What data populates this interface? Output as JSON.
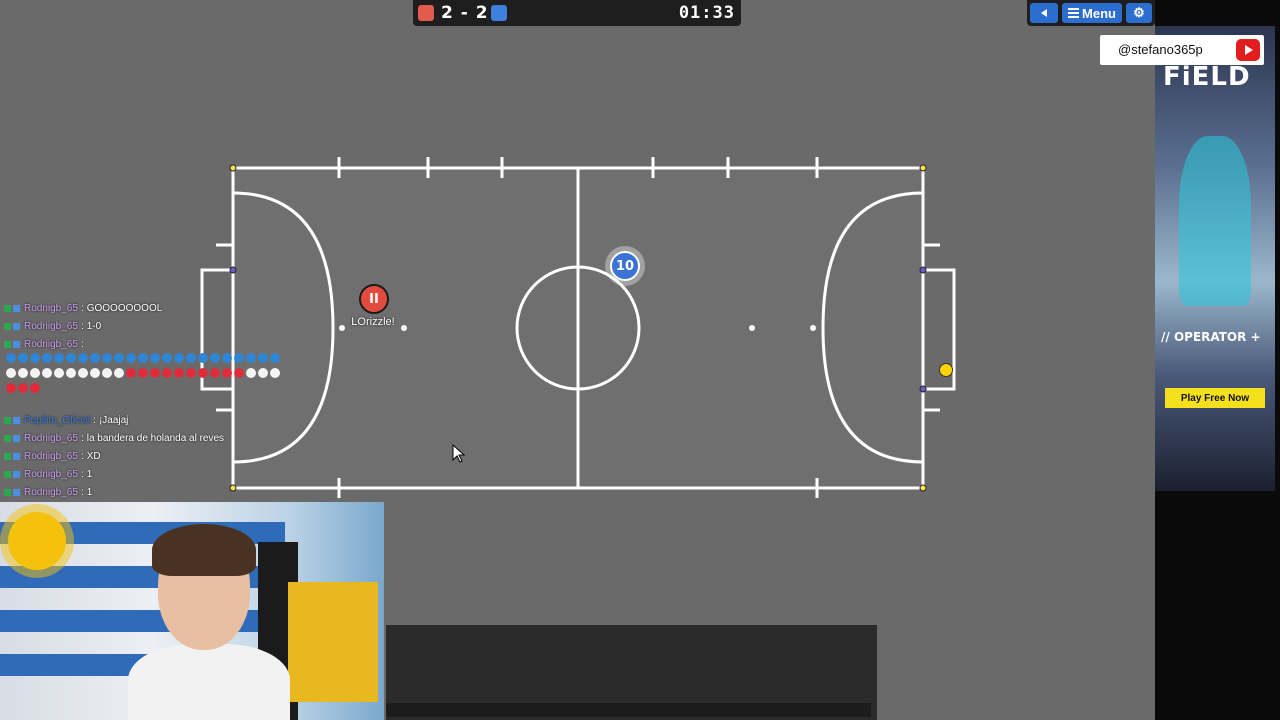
{
  "scoreboard": {
    "red_score": "2",
    "separator": "-",
    "blue_score": "2",
    "score_display": "2 - 2",
    "time": "01:33",
    "red_color": "#e35b4c",
    "blue_color": "#3f7fe0"
  },
  "menu": {
    "back_icon": "triangle-left-icon",
    "menu_label": "Menu",
    "menu_icon": "hamburger-icon",
    "settings_icon": "gear-icon"
  },
  "ad": {
    "title": "FiELD",
    "operator_label": "// OPERATOR +",
    "play_label": "Play Free Now"
  },
  "stream": {
    "handle": "@stefano365p",
    "platform_icon": "youtube-icon"
  },
  "players": {
    "red": {
      "number": "II",
      "name": "LOrizzle!"
    },
    "blue": {
      "number": "10"
    }
  },
  "chat": {
    "lines": [
      {
        "user": "Rodriigb_65",
        "sep": ":",
        "msg": "GOOOOOOOOL"
      },
      {
        "user": "Rodriigb_65",
        "sep": ":",
        "msg": "1-0"
      },
      {
        "user": "Rodriigb_65",
        "sep": ":",
        "msg": ""
      },
      {
        "user": "Pupilito_Oficial",
        "sep": ":",
        "msg": "¡Jaajaj"
      },
      {
        "user": "Rodriigb_65",
        "sep": ":",
        "msg": "la bandera de holanda al reves"
      },
      {
        "user": "Rodriigb_65",
        "sep": ":",
        "msg": "XD"
      },
      {
        "user": "Rodriigb_65",
        "sep": ":",
        "msg": "1"
      },
      {
        "user": "Rodriigb_65",
        "sep": ":",
        "msg": "1"
      }
    ],
    "emoji_rows": [
      {
        "color": "#2f86d6",
        "count": 23
      },
      {
        "color": "#f4f4f4",
        "count": 23
      },
      {
        "color": "#e02c3a",
        "count": 3
      }
    ]
  },
  "colors": {
    "field": "#6d6d6d",
    "lines": "#ffffff",
    "background": "#6a6a6a"
  }
}
